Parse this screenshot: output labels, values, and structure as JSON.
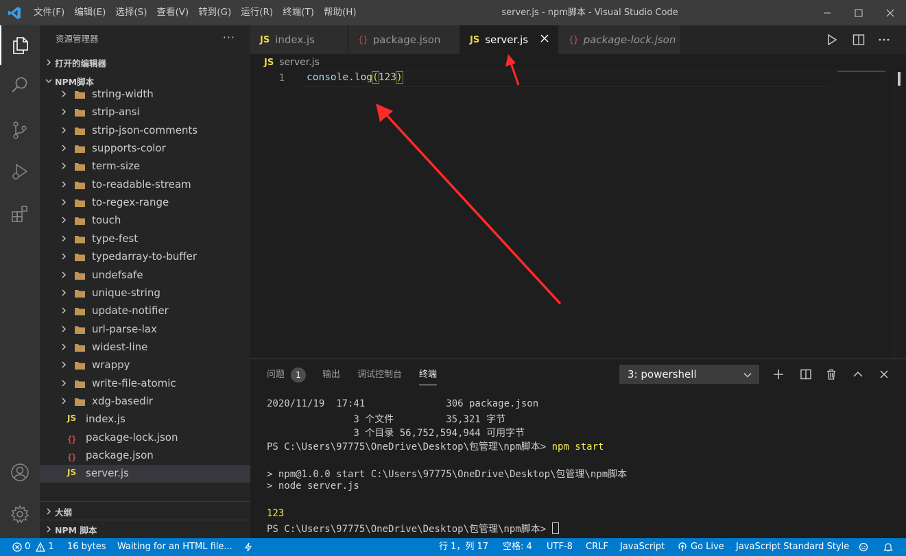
{
  "window": {
    "title": "server.js - npm脚本 - Visual Studio Code",
    "menu": [
      "文件(F)",
      "编辑(E)",
      "选择(S)",
      "查看(V)",
      "转到(G)",
      "运行(R)",
      "终端(T)",
      "帮助(H)"
    ]
  },
  "sidebar": {
    "title": "资源管理器",
    "more": "···",
    "open_editors": "打开的编辑器",
    "project": "NPM脚本",
    "folders": [
      "string-width",
      "strip-ansi",
      "strip-json-comments",
      "supports-color",
      "term-size",
      "to-readable-stream",
      "to-regex-range",
      "touch",
      "type-fest",
      "typedarray-to-buffer",
      "undefsafe",
      "unique-string",
      "update-notifier",
      "url-parse-lax",
      "widest-line",
      "wrappy",
      "write-file-atomic",
      "xdg-basedir"
    ],
    "files": [
      {
        "name": "index.js",
        "icon": "JS"
      },
      {
        "name": "package-lock.json",
        "icon": "{}"
      },
      {
        "name": "package.json",
        "icon": "{}"
      },
      {
        "name": "server.js",
        "icon": "JS"
      }
    ],
    "outline": "大纲",
    "npm_scripts": "NPM 脚本"
  },
  "tabs": [
    {
      "label": "index.js",
      "icon": "JS"
    },
    {
      "label": "package.json",
      "icon": "{}"
    },
    {
      "label": "server.js",
      "icon": "JS"
    },
    {
      "label": "package-lock.json",
      "icon": "{}"
    }
  ],
  "breadcrumb": {
    "icon": "JS",
    "file": "server.js"
  },
  "editor": {
    "line_number": "1",
    "code_ident": "console",
    "code_dot": ".",
    "code_fn": "log",
    "code_lparen": "(",
    "code_num": "123",
    "code_rparen": ")"
  },
  "panel": {
    "tabs": [
      "问题",
      "输出",
      "调试控制台",
      "终端"
    ],
    "problems_count": "1",
    "terminal_select": "3: powershell",
    "lines": {
      "l1": "2020/11/19  17:41              306 package.json",
      "l2": "               3 个文件         35,321 字节",
      "l3": "               3 个目录 56,752,594,944 可用字节",
      "l4_prompt": "PS C:\\Users\\97775\\OneDrive\\Desktop\\包管理\\npm脚本> ",
      "l4_cmd": "npm start",
      "l5": "> npm@1.0.0 start C:\\Users\\97775\\OneDrive\\Desktop\\包管理\\npm脚本",
      "l6": "> node server.js",
      "l7": "123",
      "l8_prompt": "PS C:\\Users\\97775\\OneDrive\\Desktop\\包管理\\npm脚本> "
    }
  },
  "status": {
    "errors": "0",
    "warnings": "1",
    "size": "16 bytes",
    "message": "Waiting for an HTML file...",
    "position": "行 1，列 17",
    "spaces": "空格: 4",
    "encoding": "UTF-8",
    "eol": "CRLF",
    "language": "JavaScript",
    "golive": "Go Live",
    "style": "JavaScript Standard Style"
  },
  "colors": {
    "accent": "#007acc",
    "annotation_arrow": "#ff2a2a",
    "js_icon": "#e8d44d",
    "folder": "#c09553"
  }
}
